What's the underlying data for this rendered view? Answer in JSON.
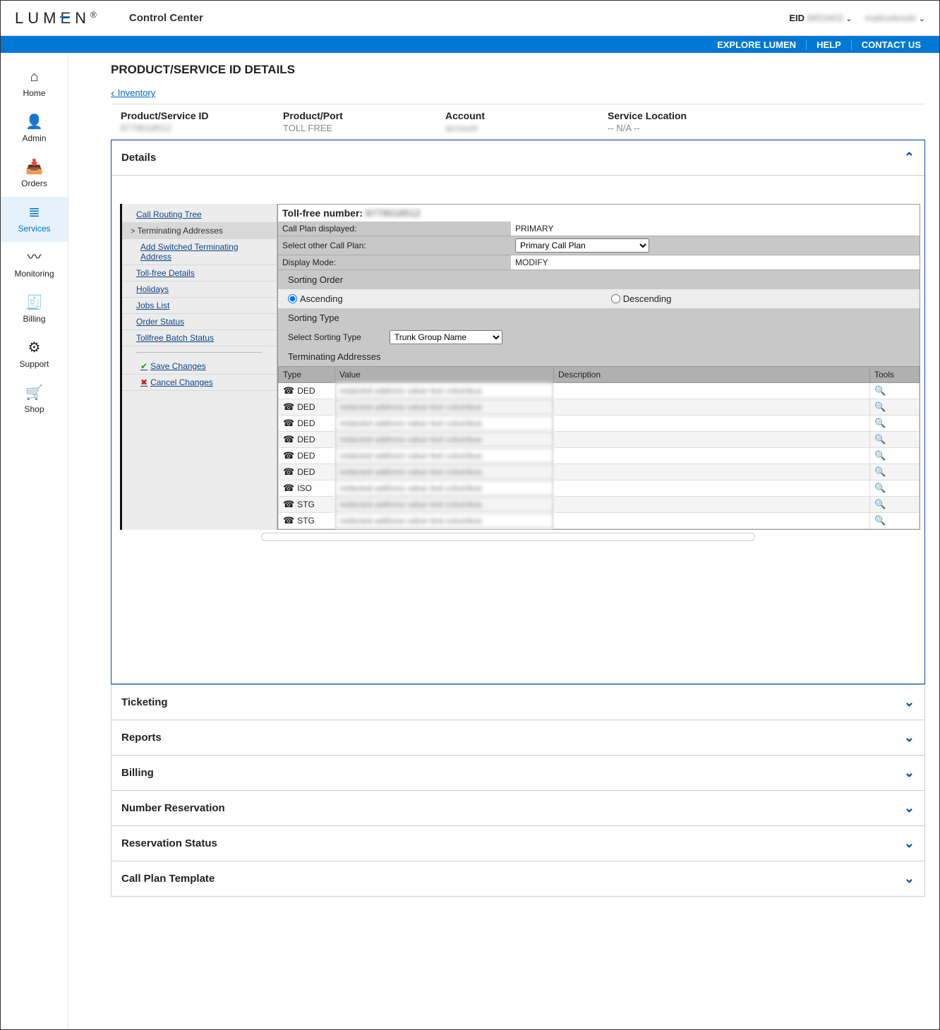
{
  "header": {
    "logo": "LUMEN",
    "app_title": "Control Center",
    "eid_label": "EID",
    "eid_value": "8853403",
    "username": "mattcelenski"
  },
  "topnav": {
    "explore": "EXPLORE LUMEN",
    "help": "HELP",
    "contact": "CONTACT US"
  },
  "sidenav": [
    {
      "icon": "⌂",
      "label": "Home"
    },
    {
      "icon": "👤",
      "label": "Admin"
    },
    {
      "icon": "📥",
      "label": "Orders"
    },
    {
      "icon": "≣",
      "label": "Services",
      "active": true
    },
    {
      "icon": "〰",
      "label": "Monitoring"
    },
    {
      "icon": "🧾",
      "label": "Billing"
    },
    {
      "icon": "⚙",
      "label": "Support"
    },
    {
      "icon": "🛒",
      "label": "Shop"
    }
  ],
  "page": {
    "title": "PRODUCT/SERVICE ID DETAILS",
    "back": "Inventory",
    "summary": [
      {
        "label": "Product/Service ID",
        "value": "8779018512"
      },
      {
        "label": "Product/Port",
        "value": "TOLL FREE"
      },
      {
        "label": "Account",
        "value": "account"
      },
      {
        "label": "Service Location",
        "value": "-- N/A --"
      }
    ]
  },
  "details": {
    "title": "Details",
    "tree": {
      "call_routing": "Call Routing Tree",
      "term_addr": "Terminating Addresses",
      "add_switched": "Add Switched Terminating Address",
      "tollfree_details": "Toll-free Details",
      "holidays": "Holidays",
      "jobs": "Jobs List",
      "order_status": "Order Status",
      "batch": "Tollfree Batch Status",
      "save": "Save Changes",
      "cancel": "Cancel Changes"
    },
    "content": {
      "tollfree_label": "Toll-free number:",
      "tollfree_value": "8779018512",
      "callplan_disp_label": "Call Plan displayed:",
      "callplan_disp_value": "PRIMARY",
      "select_other_label": "Select other Call Plan:",
      "select_other_value": "Primary Call Plan",
      "display_mode_label": "Display Mode:",
      "display_mode_value": "MODIFY",
      "sorting_order_label": "Sorting Order",
      "asc": "Ascending",
      "desc": "Descending",
      "sorting_type_label": "Sorting Type",
      "select_sorting_label": "Select Sorting Type",
      "select_sorting_value": "Trunk Group Name",
      "ta_label": "Terminating Addresses",
      "cols": {
        "type": "Type",
        "value": "Value",
        "desc": "Description",
        "tools": "Tools"
      },
      "rows": [
        {
          "type": "DED",
          "value": "redacted address value text columbus"
        },
        {
          "type": "DED",
          "value": "redacted address value text columbus"
        },
        {
          "type": "DED",
          "value": "redacted address value text columbus"
        },
        {
          "type": "DED",
          "value": "redacted address value text columbus"
        },
        {
          "type": "DED",
          "value": "redacted address value text columbus"
        },
        {
          "type": "DED",
          "value": "redacted address value text columbus"
        },
        {
          "type": "ISO",
          "value": "redacted address value text columbus"
        },
        {
          "type": "STG",
          "value": "redacted address value text columbus"
        },
        {
          "type": "STG",
          "value": "redacted address value text columbus"
        }
      ]
    }
  },
  "accordion": [
    "Ticketing",
    "Reports",
    "Billing",
    "Number Reservation",
    "Reservation Status",
    "Call Plan Template"
  ]
}
